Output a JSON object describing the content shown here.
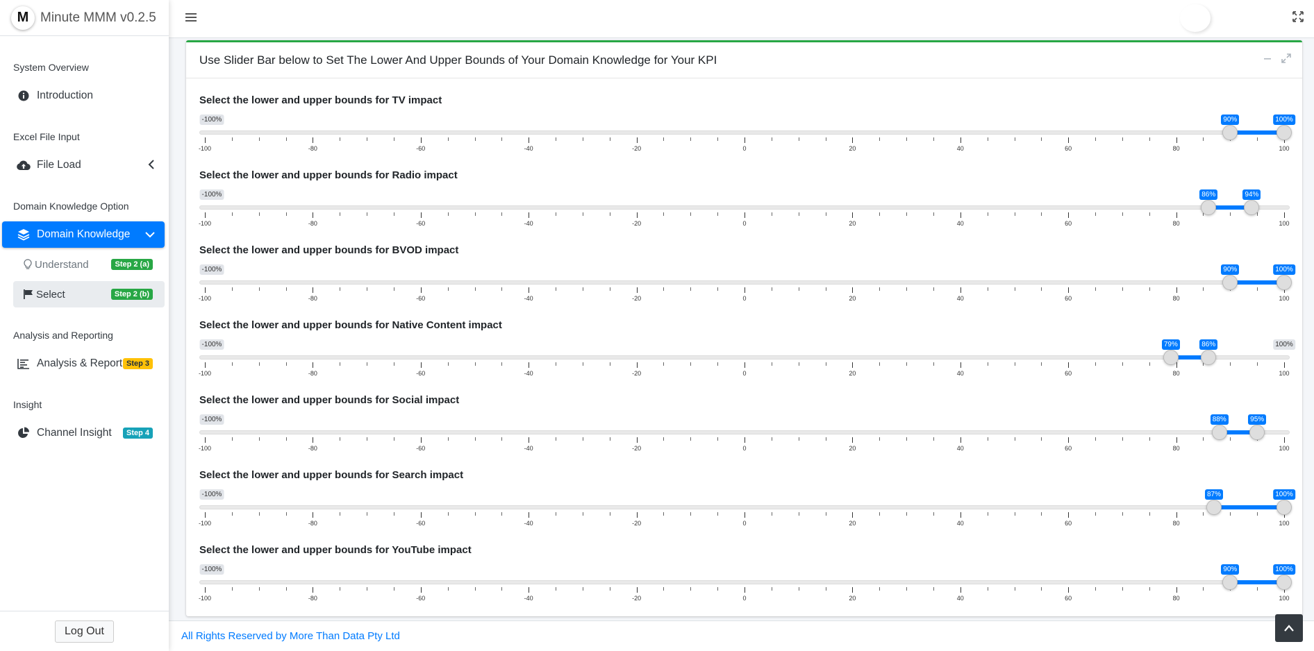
{
  "brand": {
    "logo_letter": "M",
    "name": "Minute MMM v0.2.5"
  },
  "sidebar": {
    "sections": [
      {
        "header": "System Overview",
        "items": [
          {
            "label": "Introduction",
            "icon": "info-circle-icon"
          }
        ]
      },
      {
        "header": "Excel File Input",
        "items": [
          {
            "label": "File Load",
            "icon": "cloud-upload-icon"
          }
        ]
      },
      {
        "header": "Domain Knowledge Option",
        "items": [
          {
            "label": "Domain Knowledge",
            "icon": "layers-icon",
            "active": true
          }
        ]
      },
      {
        "header": "Analysis and Reporting",
        "items": [
          {
            "label": "Analysis & Report",
            "icon": "line-chart-icon",
            "badge": "Step 3"
          }
        ]
      },
      {
        "header": "Insight",
        "items": [
          {
            "label": "Channel Insight",
            "icon": "pie-chart-icon",
            "badge": "Step 4"
          }
        ]
      }
    ],
    "subitems": [
      {
        "label": "Understand",
        "icon": "lightbulb-icon",
        "badge": "Step 2 (a)"
      },
      {
        "label": "Select",
        "icon": "flag-icon",
        "badge": "Step 2 (b)",
        "current": true
      }
    ],
    "logout_label": "Log Out"
  },
  "card": {
    "title": "Use Slider Bar below to Set The Lower And Upper Bounds of Your Domain Knowledge for Your KPI"
  },
  "slider_common": {
    "min_label": "-100%",
    "max_label": "100%",
    "ticks": [
      "-100",
      "-80",
      "-60",
      "-40",
      "-20",
      "0",
      "20",
      "40",
      "60",
      "80",
      "100"
    ]
  },
  "sliders": [
    {
      "label": "Select the lower and upper bounds for TV impact",
      "from": 90,
      "to": 100,
      "from_label": "90%",
      "to_label": "100%"
    },
    {
      "label": "Select the lower and upper bounds for Radio impact",
      "from": 86,
      "to": 94,
      "from_label": "86%",
      "to_label": "94%"
    },
    {
      "label": "Select the lower and upper bounds for BVOD impact",
      "from": 90,
      "to": 100,
      "from_label": "90%",
      "to_label": "100%"
    },
    {
      "label": "Select the lower and upper bounds for Native Content impact",
      "from": 79,
      "to": 86,
      "from_label": "79%",
      "to_label": "86%"
    },
    {
      "label": "Select the lower and upper bounds for Social impact",
      "from": 88,
      "to": 95,
      "from_label": "88%",
      "to_label": "95%"
    },
    {
      "label": "Select the lower and upper bounds for Search impact",
      "from": 87,
      "to": 100,
      "from_label": "87%",
      "to_label": "100%"
    },
    {
      "label": "Select the lower and upper bounds for YouTube impact",
      "from": 90,
      "to": 100,
      "from_label": "90%",
      "to_label": "100%"
    }
  ],
  "footer": {
    "text": "All Rights Reserved by More Than Data Pty Ltd"
  },
  "colors": {
    "accent": "#007bff",
    "card_top_border": "#28a745",
    "badge_green": "#28a745",
    "badge_yellow": "#ffc107",
    "badge_teal": "#17a2b8"
  }
}
